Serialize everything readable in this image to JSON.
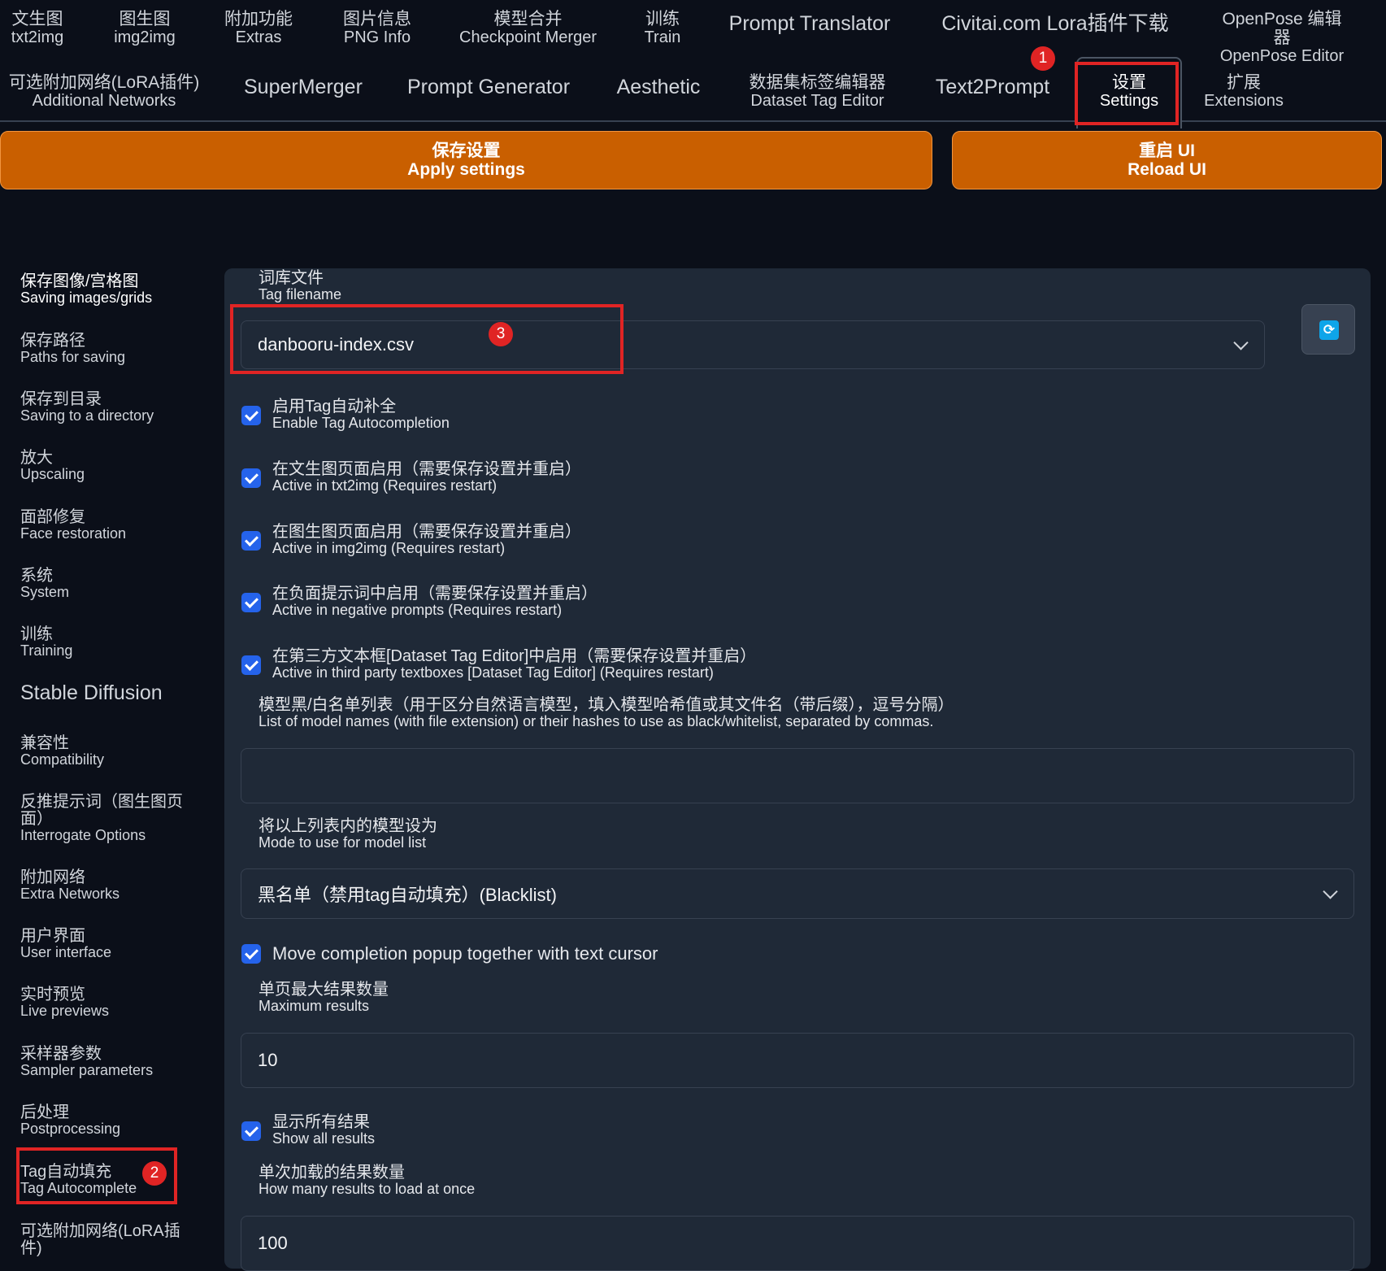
{
  "nav": {
    "row1": [
      {
        "zh": "文生图",
        "en": "txt2img"
      },
      {
        "zh": "图生图",
        "en": "img2img"
      },
      {
        "zh": "附加功能",
        "en": "Extras"
      },
      {
        "zh": "图片信息",
        "en": "PNG Info"
      },
      {
        "zh": "模型合并",
        "en": "Checkpoint Merger"
      },
      {
        "zh": "训练",
        "en": "Train"
      },
      {
        "label": "Prompt Translator"
      },
      {
        "label": "Civitai.com Lora插件下载"
      },
      {
        "zh": "OpenPose 编辑器",
        "en": "OpenPose Editor"
      }
    ],
    "row2": [
      {
        "zh": "可选附加网络(LoRA插件)",
        "en": "Additional Networks"
      },
      {
        "label": "SuperMerger"
      },
      {
        "label": "Prompt Generator"
      },
      {
        "label": "Aesthetic"
      },
      {
        "zh": "数据集标签编辑器",
        "en": "Dataset Tag Editor"
      },
      {
        "label": "Text2Prompt"
      },
      {
        "zh": "设置",
        "en": "Settings"
      },
      {
        "zh": "扩展",
        "en": "Extensions"
      }
    ]
  },
  "buttons": {
    "apply": {
      "zh": "保存设置",
      "en": "Apply settings"
    },
    "reload": {
      "zh": "重启 UI",
      "en": "Reload UI"
    }
  },
  "badges": [
    "1",
    "2",
    "3"
  ],
  "sidebar": {
    "items_top": [
      {
        "zh": "保存图像/宫格图",
        "en": "Saving images/grids"
      },
      {
        "zh": "保存路径",
        "en": "Paths for saving"
      },
      {
        "zh": "保存到目录",
        "en": "Saving to a directory"
      },
      {
        "zh": "放大",
        "en": "Upscaling"
      },
      {
        "zh": "面部修复",
        "en": "Face restoration"
      },
      {
        "zh": "系统",
        "en": "System"
      },
      {
        "zh": "训练",
        "en": "Training"
      }
    ],
    "heading": "Stable Diffusion",
    "items_bottom": [
      {
        "zh": "兼容性",
        "en": "Compatibility"
      },
      {
        "zh": "反推提示词（图生图页面）",
        "en": "Interrogate Options"
      },
      {
        "zh": "附加网络",
        "en": "Extra Networks"
      },
      {
        "zh": "用户界面",
        "en": "User interface"
      },
      {
        "zh": "实时预览",
        "en": "Live previews"
      },
      {
        "zh": "采样器参数",
        "en": "Sampler parameters"
      },
      {
        "zh": "后处理",
        "en": "Postprocessing"
      },
      {
        "zh": "Tag自动填充",
        "en": "Tag Autocomplete"
      },
      {
        "zh": "可选附加网络(LoRA插件)",
        "en": ""
      }
    ]
  },
  "settings": {
    "tag_filename": {
      "zh": "词库文件",
      "en": "Tag filename",
      "value": "danbooru-index.csv"
    },
    "checks": [
      {
        "zh": "启用Tag自动补全",
        "en": "Enable Tag Autocompletion",
        "checked": true
      },
      {
        "zh": "在文生图页面启用（需要保存设置并重启）",
        "en": "Active in txt2img (Requires restart)",
        "checked": true
      },
      {
        "zh": "在图生图页面启用（需要保存设置并重启）",
        "en": "Active in img2img (Requires restart)",
        "checked": true
      },
      {
        "zh": "在负面提示词中启用（需要保存设置并重启）",
        "en": "Active in negative prompts (Requires restart)",
        "checked": true
      },
      {
        "zh": "在第三方文本框[Dataset Tag Editor]中启用（需要保存设置并重启）",
        "en": "Active in third party textboxes [Dataset Tag Editor] (Requires restart)",
        "checked": true
      }
    ],
    "model_list": {
      "zh": "模型黑/白名单列表（用于区分自然语言模型，填入模型哈希值或其文件名（带后缀），逗号分隔）",
      "en": "List of model names (with file extension) or their hashes to use as black/whitelist, separated by commas.",
      "value": ""
    },
    "mode": {
      "zh": "将以上列表内的模型设为",
      "en": "Mode to use for model list",
      "value": "黑名单（禁用tag自动填充）(Blacklist)"
    },
    "move_popup": {
      "label": "Move completion popup together with text cursor",
      "checked": true
    },
    "max_results": {
      "zh": "单页最大结果数量",
      "en": "Maximum results",
      "value": "10"
    },
    "show_all": {
      "zh": "显示所有结果",
      "en": "Show all results",
      "checked": true
    },
    "load_at_once": {
      "zh": "单次加载的结果数量",
      "en": "How many results to load at once",
      "value": "100"
    }
  }
}
